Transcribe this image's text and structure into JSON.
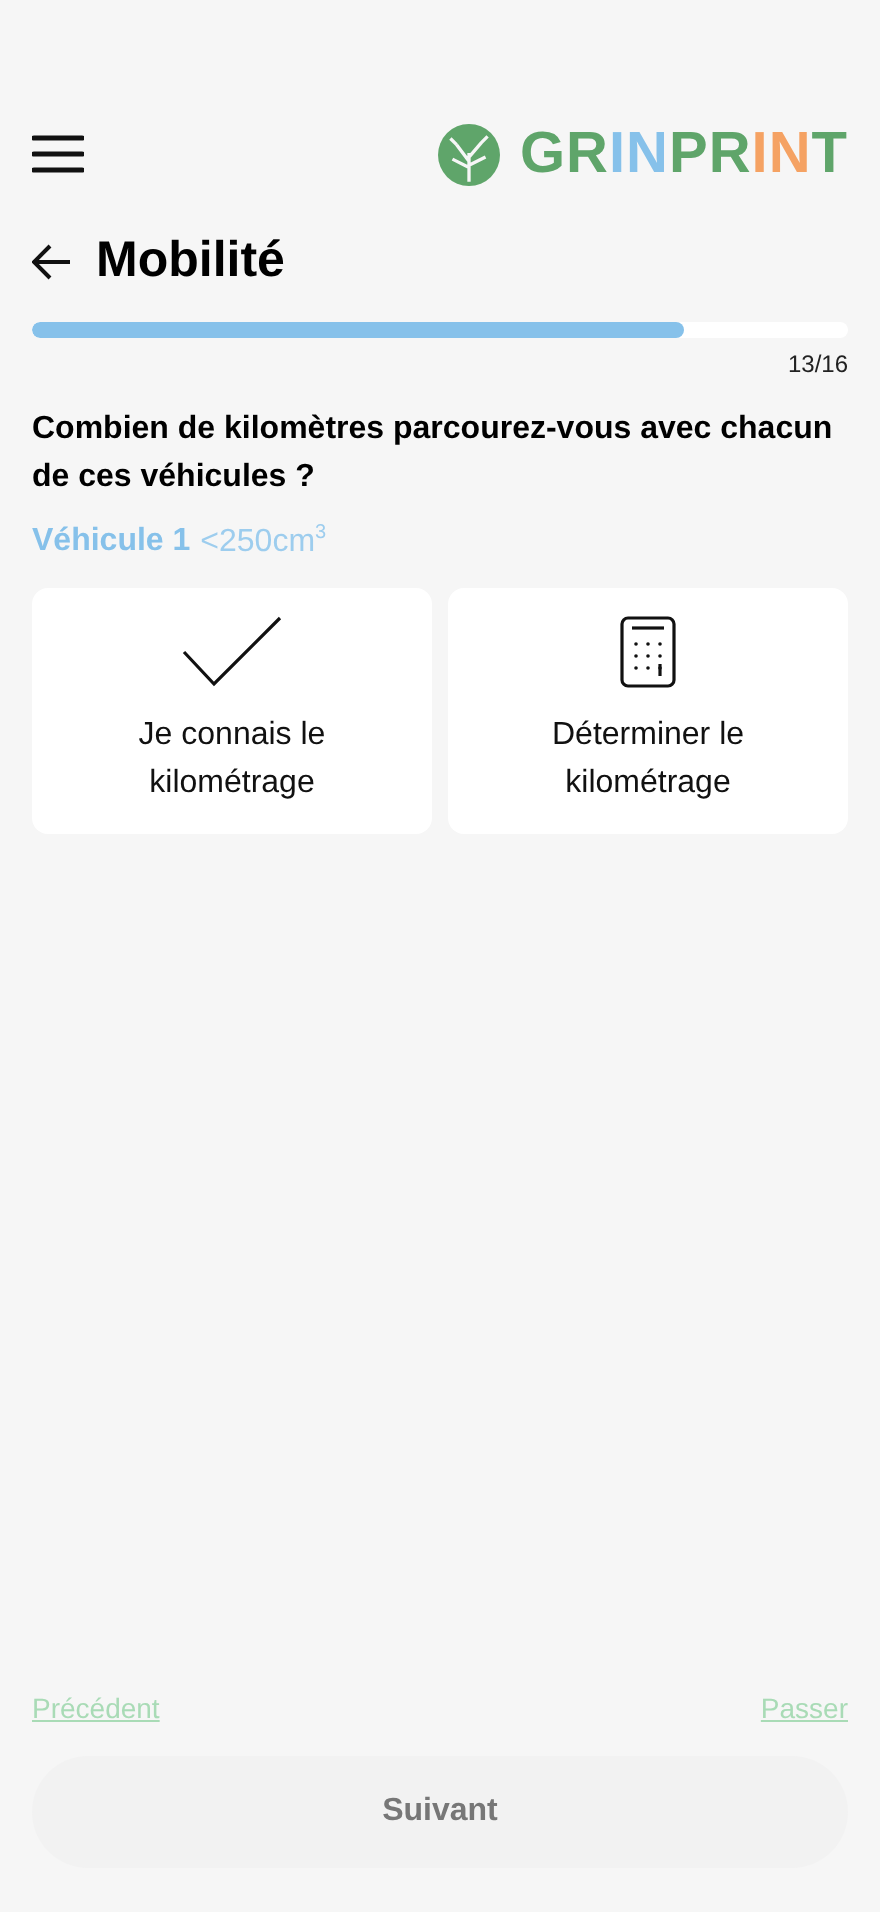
{
  "logo": {
    "segments": [
      {
        "text": "GR",
        "color": "#5fa56a"
      },
      {
        "text": "IN",
        "color": "#86c1ea"
      },
      {
        "text": "PR",
        "color": "#5fa56a"
      },
      {
        "text": "IN",
        "color": "#f5a263"
      },
      {
        "text": "T",
        "color": "#5fa56a"
      }
    ]
  },
  "header": {
    "title": "Mobilité"
  },
  "progress": {
    "level": 0.8,
    "reading": "13/16"
  },
  "question": "Combien de kilomètres parcourez-vous avec chacun de ces véhicules ?",
  "vehicle": {
    "label": "Véhicule 1",
    "detail": "<250cm$^{3}$"
  },
  "options": [
    {
      "kind": "check",
      "label": "Je connais le kilométrage"
    },
    {
      "kind": "calculator",
      "label": "Déterminer le kilométrage"
    }
  ],
  "footer": {
    "previous": "Précédent",
    "skip": "Passer",
    "next": {
      "label": "Suivant",
      "disabled": true
    }
  }
}
